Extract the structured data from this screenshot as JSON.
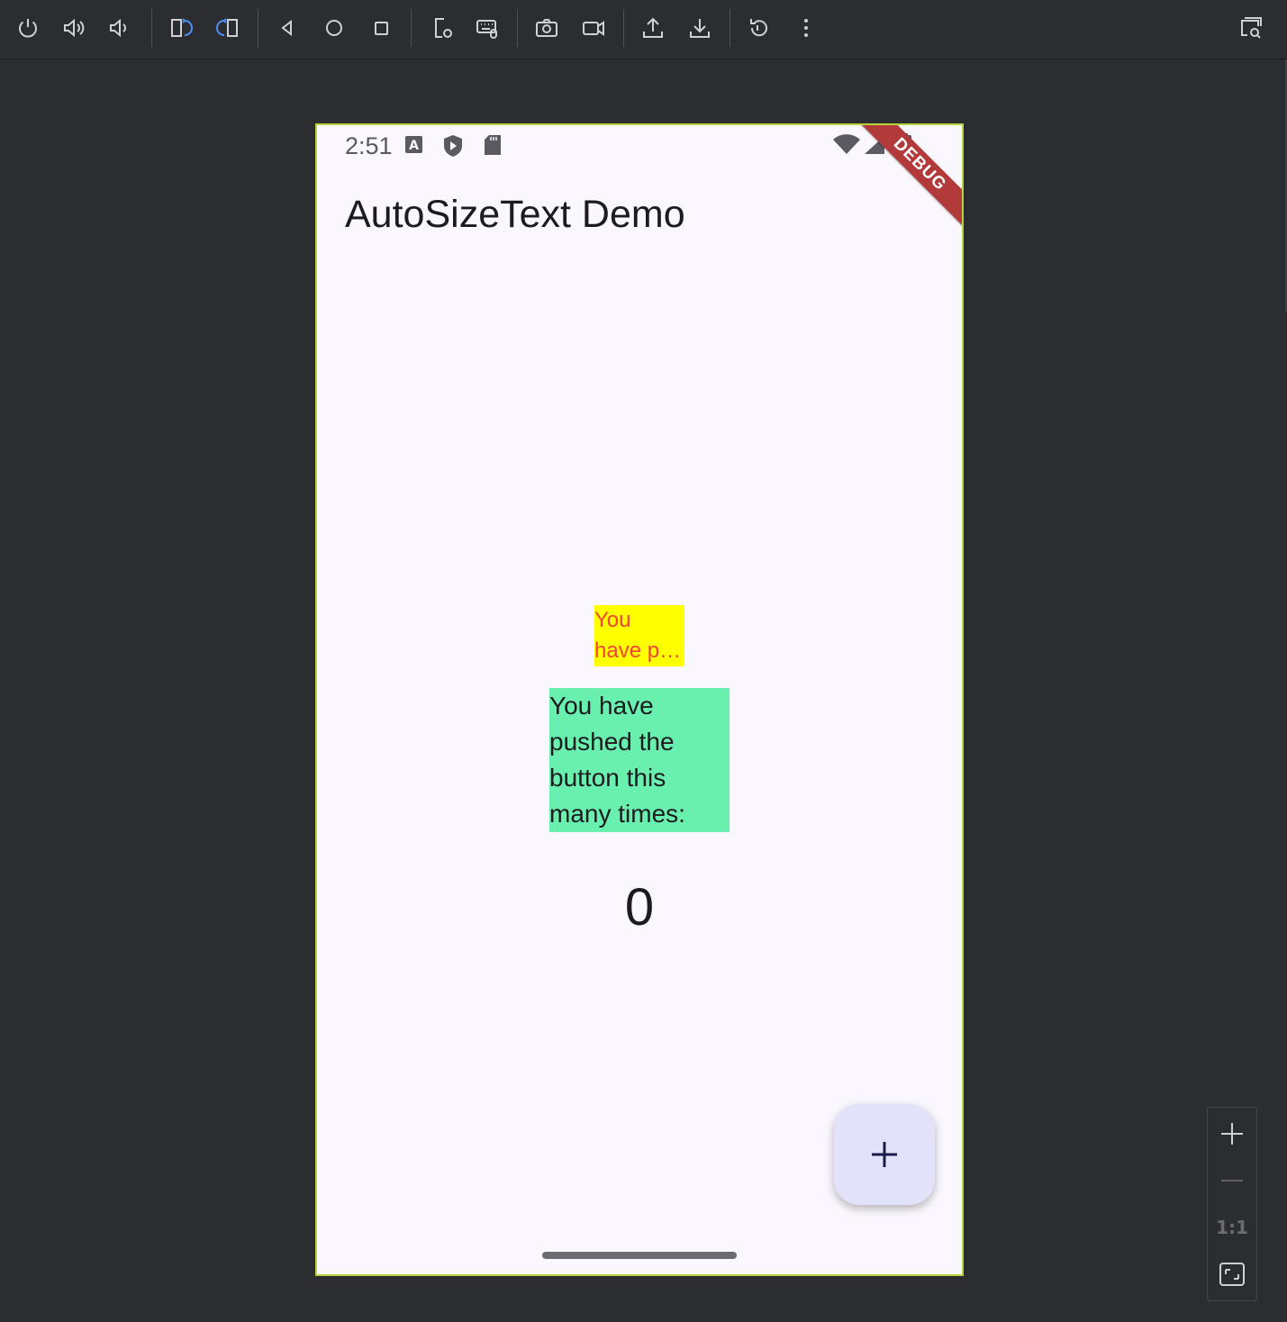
{
  "toolbar": {
    "icons": [
      "power-icon",
      "volume-up-icon",
      "volume-down-icon",
      "rotate-left-icon",
      "rotate-right-icon",
      "back-icon",
      "home-icon",
      "overview-icon",
      "device-settings-icon",
      "keyboard-icon",
      "camera-icon",
      "video-record-icon",
      "upload-icon",
      "download-icon",
      "reset-icon",
      "more-icon",
      "layout-inspector-icon"
    ]
  },
  "status_bar": {
    "time": "2:51",
    "debug_label": "DEBUG"
  },
  "app": {
    "title": "AutoSizeText Demo",
    "yellow_text_line1": "You",
    "yellow_text_line2": "have p…",
    "green_text_lines": [
      "You have",
      "pushed the",
      "button this",
      "many times:"
    ],
    "counter": "0",
    "fab_label": "+"
  },
  "zoom": {
    "ratio_label": "1:1"
  },
  "colors": {
    "phone_border": "#b5d33a",
    "yellow_box": "#ffff00",
    "yellow_text": "#f14436",
    "green_box": "#69f0ae",
    "fab_bg": "#e2e3fb",
    "ide_bg": "#2b2d30"
  }
}
